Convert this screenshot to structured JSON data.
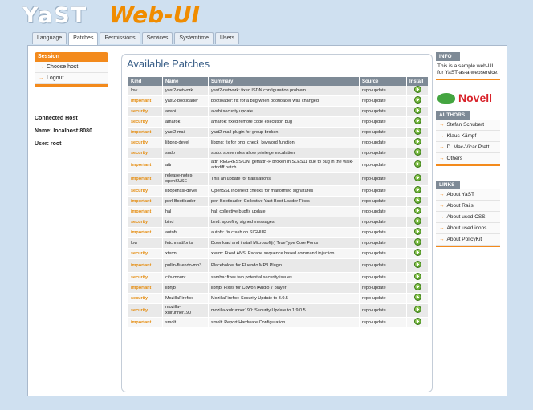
{
  "header": {
    "logo_yast": "YaST",
    "logo_webui": "Web-UI"
  },
  "tabs": [
    "Language",
    "Patches",
    "Permissions",
    "Services",
    "Systemtime",
    "Users"
  ],
  "session": {
    "title": "Session",
    "items": [
      "Choose host",
      "Logout"
    ]
  },
  "host": {
    "heading": "Connected Host",
    "name": "Name: localhost:8080",
    "user": "User: root"
  },
  "main": {
    "title": "Available Patches",
    "columns": [
      "Kind",
      "Name",
      "Summary",
      "Source",
      "Install"
    ],
    "rows": [
      {
        "kind": "low",
        "name": "yast2-network",
        "summary": "yast2-network: fixed ISDN configuration problem",
        "source": "repo-update"
      },
      {
        "kind": "important",
        "name": "yast2-bootloader",
        "summary": "bootloader: fix for a bug when bootloader was changed",
        "source": "repo-update"
      },
      {
        "kind": "security",
        "name": "avahi",
        "summary": "avahi security update",
        "source": "repo-update"
      },
      {
        "kind": "security",
        "name": "amarok",
        "summary": "amarok: fixed remote code execution bug",
        "source": "repo-update"
      },
      {
        "kind": "important",
        "name": "yast2-mail",
        "summary": "yast2-mail-plugin for group broken",
        "source": "repo-update"
      },
      {
        "kind": "security",
        "name": "libpng-devel",
        "summary": "libpng: fix for png_check_keyword function",
        "source": "repo-update"
      },
      {
        "kind": "security",
        "name": "sudo",
        "summary": "sudo: some rules allow privilege escalation",
        "source": "repo-update"
      },
      {
        "kind": "important",
        "name": "attr",
        "summary": "attr: REGRESSION: getfattr -P broken in SLES11 due to bug in the walk-attr.diff patch",
        "source": "repo-update"
      },
      {
        "kind": "important",
        "name": "release-notes-openSUSE",
        "summary": "This an update for translations",
        "source": "repo-update"
      },
      {
        "kind": "security",
        "name": "libopenssl-devel",
        "summary": "OpenSSL incorrect checks for malformed signatures",
        "source": "repo-update"
      },
      {
        "kind": "important",
        "name": "perl-Bootloader",
        "summary": "perl-Bootloader: Collective Yast Boot Loader Fixes",
        "source": "repo-update"
      },
      {
        "kind": "important",
        "name": "hal",
        "summary": "hal: collective bugfix update",
        "source": "repo-update"
      },
      {
        "kind": "security",
        "name": "bind",
        "summary": "bind: spoofing signed messages",
        "source": "repo-update"
      },
      {
        "kind": "important",
        "name": "autofs",
        "summary": "autofs: fix crash on SIGHUP",
        "source": "repo-update"
      },
      {
        "kind": "low",
        "name": "fetchmsttfonts",
        "summary": "Download and install Microsoft(r) TrueType Core Fonts",
        "source": "repo-update"
      },
      {
        "kind": "security",
        "name": "xterm",
        "summary": "xterm: Fixed ANSI Escape sequence based command injection",
        "source": "repo-update"
      },
      {
        "kind": "important",
        "name": "pullin-fluendo-mp3",
        "summary": "Placeholder for Fluendo MP3 Plugin",
        "source": "repo-update"
      },
      {
        "kind": "security",
        "name": "cifs-mount",
        "summary": "samba: fixes two potential security issues",
        "source": "repo-update"
      },
      {
        "kind": "important",
        "name": "libnjb",
        "summary": "libnjb: Fixes for Cowon iAudio 7 player",
        "source": "repo-update"
      },
      {
        "kind": "security",
        "name": "MozillaFirefox",
        "summary": "MozillaFirefox: Security Update to 3.0.5",
        "source": "repo-update"
      },
      {
        "kind": "security",
        "name": "mozilla-xulrunner190",
        "summary": "mozilla-xulrunner190: Security Update to 1.9.0.5",
        "source": "repo-update"
      },
      {
        "kind": "important",
        "name": "smolt",
        "summary": "smolt: Report Hardware Configuration",
        "source": "repo-update"
      }
    ]
  },
  "info": {
    "title": "INFO",
    "text": "This is a sample web-UI for YaST-as-a-webservice.",
    "logo": "Novell"
  },
  "authors": {
    "title": "AUTHORS",
    "items": [
      "Stefan Schubert",
      "Klaus Kämpf",
      "D. Mac-Vicar Prett",
      "Others"
    ]
  },
  "links": {
    "title": "LINKS",
    "items": [
      "About YaST",
      "About Rails",
      "About used CSS",
      "About used icons",
      "About PolicyKit"
    ]
  },
  "colors": {
    "accent": "#f38a1c",
    "header_bg": "#7e8a96",
    "page_bg": "#cfe0f0",
    "title": "#3a5f88"
  },
  "icons": {
    "install": "install-plus-icon",
    "list_bullet": "arrow-bullet-icon"
  }
}
